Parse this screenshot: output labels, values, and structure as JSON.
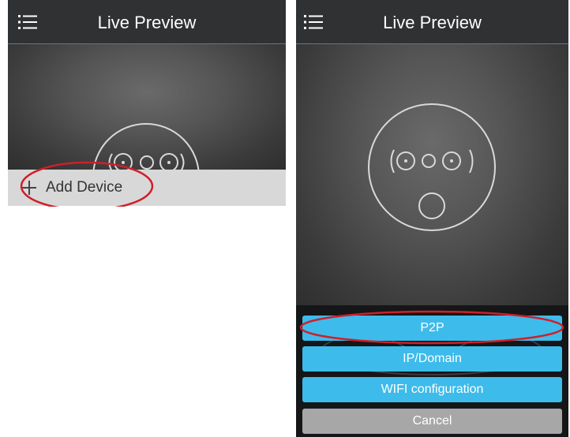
{
  "left_screen": {
    "header": {
      "title": "Live Preview",
      "menu_icon": "list-menu-icon"
    },
    "add_device": {
      "label": "Add Device",
      "icon": "plus-icon"
    }
  },
  "right_screen": {
    "header": {
      "title": "Live Preview",
      "menu_icon": "list-menu-icon"
    },
    "buttons": [
      {
        "label": "P2P",
        "style": "blue"
      },
      {
        "label": "IP/Domain",
        "style": "blue"
      },
      {
        "label": "WIFI configuration",
        "style": "blue"
      },
      {
        "label": "Cancel",
        "style": "gray"
      }
    ]
  },
  "colors": {
    "topbar": "#2f3133",
    "accent_blue": "#3dbbeb",
    "cancel_gray": "#a7a7a7",
    "highlight_red": "#d01f2a"
  }
}
